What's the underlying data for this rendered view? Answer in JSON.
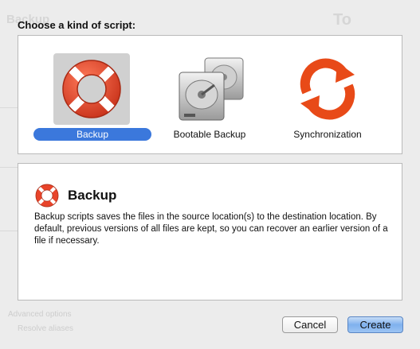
{
  "dialog": {
    "heading": "Choose a kind of script:",
    "background_hint_to": "To",
    "background_hint_behind": "Backup",
    "background_hint_advanced": "Advanced options",
    "background_hint_resolve": "Resolve aliases"
  },
  "script_types": [
    {
      "label": "Backup",
      "icon": "lifebuoy-icon",
      "selected": true
    },
    {
      "label": "Bootable Backup",
      "icon": "hard-drives-icon",
      "selected": false
    },
    {
      "label": "Synchronization",
      "icon": "sync-arrows-icon",
      "selected": false
    }
  ],
  "description": {
    "title": "Backup",
    "icon": "lifebuoy-icon",
    "body": "Backup scripts saves the files in the source location(s) to the destination location. By default, previous versions of all files are kept, so you can recover an earlier version of a file if necessary."
  },
  "buttons": {
    "cancel": "Cancel",
    "create": "Create"
  },
  "colors": {
    "selection_accent": "#3b78dc",
    "lifebuoy_red": "#e8442a",
    "sync_orange": "#e84a18"
  }
}
